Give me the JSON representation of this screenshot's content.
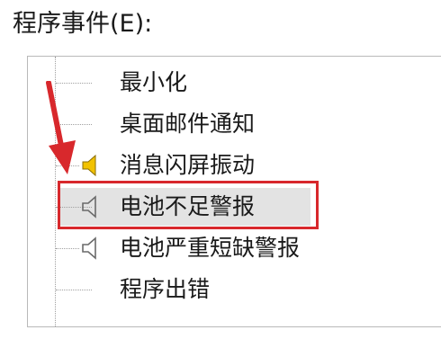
{
  "section_label": "程序事件(E):",
  "events": [
    {
      "label": "最小化",
      "icon": "none"
    },
    {
      "label": "桌面邮件通知",
      "icon": "none"
    },
    {
      "label": "消息闪屏振动",
      "icon": "speaker-active"
    },
    {
      "label": "电池不足警报",
      "icon": "speaker-muted",
      "selected": true
    },
    {
      "label": "电池严重短缺警报",
      "icon": "speaker-muted"
    },
    {
      "label": "程序出错",
      "icon": "none"
    }
  ],
  "colors": {
    "highlight_border": "#d8282c",
    "arrow": "#d8282c",
    "speaker_active": "#f2c200",
    "selected_bg": "#e3e3e3"
  },
  "annotations": {
    "arrow_icon": "red-arrow-down-icon",
    "highlight_target": "电池不足警报"
  }
}
